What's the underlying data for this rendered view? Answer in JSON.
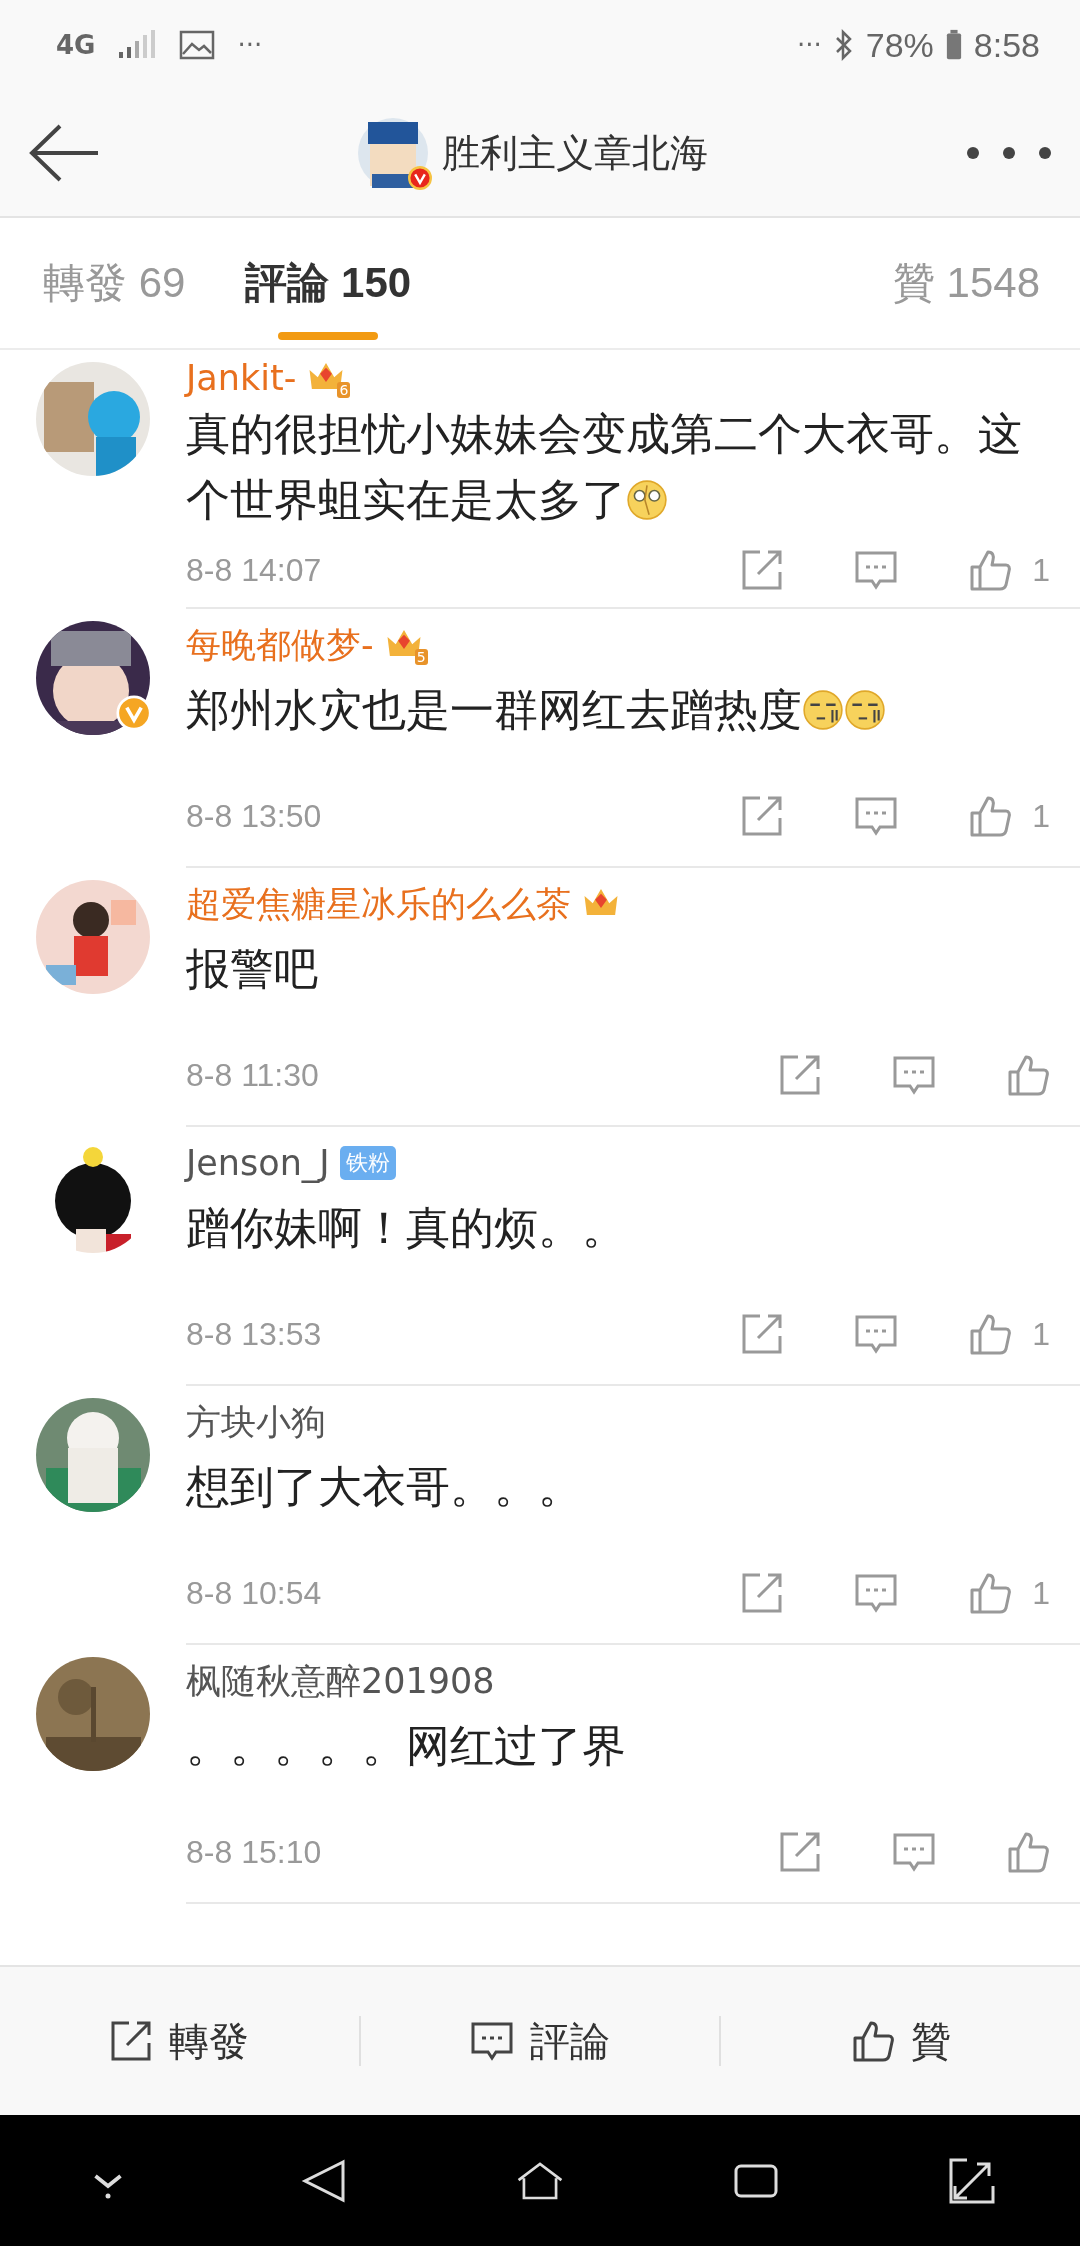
{
  "status_bar": {
    "network": "4G",
    "left_more": "···",
    "right_more": "···",
    "battery": "78%",
    "time": "8:58"
  },
  "header": {
    "title": "胜利主义章北海",
    "verified": true
  },
  "tabs": [
    {
      "label": "轉發 69",
      "selected": false
    },
    {
      "label": "評論 150",
      "selected": true
    },
    {
      "label": "贊 1548",
      "selected": false
    }
  ],
  "comments": [
    {
      "name": "Jankit-",
      "vip": true,
      "crown_rank": "6",
      "verified": false,
      "text": "真的很担忧小妹妹会变成第二个大衣哥。这个世界蛆实在是太多了",
      "emoji": [
        {
          "kind": "dizzy"
        }
      ],
      "time": "8-8 14:07",
      "likes": "1"
    },
    {
      "name": "每晚都做梦-",
      "vip": true,
      "crown_rank": "5",
      "verified": true,
      "text": "郑州水灾也是一群网红去蹭热度",
      "emoji": [
        {
          "kind": "smirk"
        },
        {
          "kind": "smirk"
        }
      ],
      "time": "8-8 13:50",
      "likes": "1"
    },
    {
      "name": "超爱焦糖星冰乐的么么茶",
      "vip": true,
      "verified": false,
      "text": "报警吧",
      "time": "8-8 11:30"
    },
    {
      "name": "Jenson_J",
      "vip": false,
      "tag": "铁粉",
      "verified": false,
      "text": "蹭你妹啊！真的烦。。",
      "time": "8-8 13:53",
      "likes": "1"
    },
    {
      "name": "方块小狗",
      "vip": false,
      "verified": false,
      "text": "想到了大衣哥。。。",
      "time": "8-8 10:54",
      "likes": "1"
    },
    {
      "name": "枫随秋意醉201908",
      "vip": false,
      "verified": false,
      "text": "。。。。。网红过了界",
      "time": "8-8 15:10"
    }
  ],
  "bottom_bar": [
    {
      "kind": "share",
      "label": "轉發"
    },
    {
      "kind": "comment",
      "label": "評論"
    },
    {
      "kind": "like",
      "label": "贊"
    }
  ]
}
